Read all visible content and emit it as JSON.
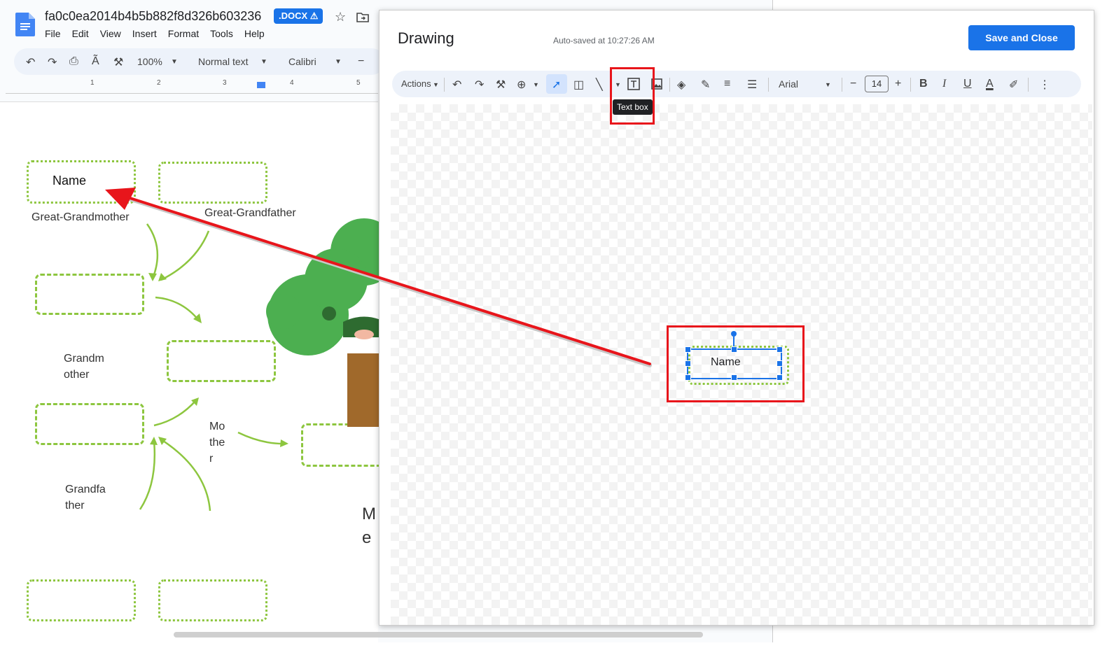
{
  "docs": {
    "title": "fa0c0ea2014b4b5b882f8d326b603236",
    "badge": ".DOCX ⚠",
    "menu": [
      "File",
      "Edit",
      "View",
      "Insert",
      "Format",
      "Tools",
      "Help"
    ],
    "toolbar": {
      "zoom": "100%",
      "style": "Normal text",
      "font": "Calibri"
    },
    "ruler_numbers": [
      "1",
      "2",
      "3",
      "4",
      "5"
    ],
    "labels": {
      "name": "Name",
      "great_grandmother": "Great-Grandmother",
      "great_grandfather": "Great-Grandfather",
      "grandmother_1": "Grandm",
      "grandmother_2": "other",
      "mother_1": "Mo",
      "mother_2": "the",
      "mother_3": "r",
      "grandfather_1": "Grandfa",
      "grandfather_2": "ther",
      "me_1": "M",
      "me_2": "e"
    }
  },
  "drawing": {
    "title": "Drawing",
    "autosave": "Auto-saved at 10:27:26 AM",
    "save_button": "Save and Close",
    "toolbar": {
      "actions": "Actions",
      "font": "Arial",
      "font_size": "14"
    },
    "tooltip": "Text box",
    "text_box": "Name"
  },
  "colors": {
    "accent": "#1a73e8",
    "highlight": "#e8151b",
    "box_border": "#8dc63f",
    "tree_green": "#4caf50"
  },
  "icons": [
    "docs-logo",
    "star-icon",
    "move-folder-icon",
    "undo-icon",
    "redo-icon",
    "print-icon",
    "spellcheck-icon",
    "paint-format-icon",
    "zoom-icon",
    "select-icon",
    "shape-icon",
    "line-icon",
    "text-box-icon",
    "image-icon",
    "fill-color-icon",
    "border-color-icon",
    "border-weight-icon",
    "border-dash-icon",
    "bold-icon",
    "italic-icon",
    "underline-icon",
    "text-color-icon",
    "highlight-icon",
    "more-icon"
  ]
}
